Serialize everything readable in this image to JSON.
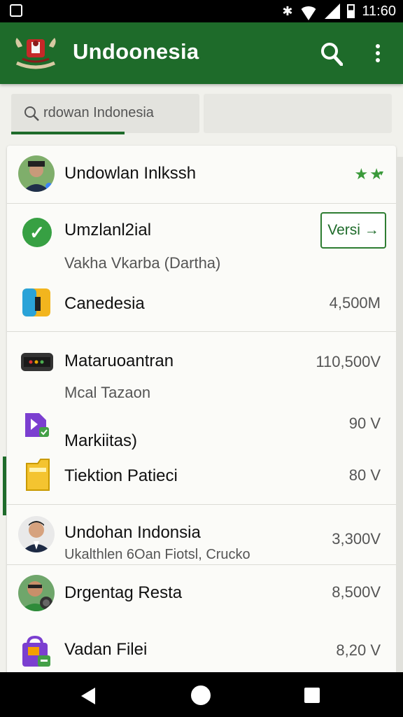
{
  "status_bar": {
    "time": "11:60"
  },
  "app_bar": {
    "title": "Undoonesia"
  },
  "search": {
    "text": "rdowan Indonesia"
  },
  "list": [
    {
      "title": "Undowlan Inlkssh",
      "value": "★★"
    },
    {
      "title": "Umzlanl2ial",
      "subtitle": "Vakha Vkarba (Dartha)",
      "button_label": "Versi →"
    },
    {
      "title": "Canedesia",
      "value": "4,500M"
    },
    {
      "title": "Mataruoantran",
      "subtitle": "Mcal Tazaon",
      "value": "110,500V"
    },
    {
      "title": "Markiitas)",
      "value": "90 V"
    },
    {
      "title": "Tiektion Patieci",
      "value": "80 V"
    },
    {
      "title": "Undohan Indonsia",
      "subtitle": "Ukalthlen 6Oan Fiotsl, Crucko",
      "value": "3,300V"
    },
    {
      "title": "Drgentag Resta",
      "value": "8,500V"
    },
    {
      "title": "Vadan Filei",
      "value": "8,20 V"
    }
  ],
  "colors": {
    "primary": "#1e6b2a",
    "accent_green": "#37a043"
  }
}
